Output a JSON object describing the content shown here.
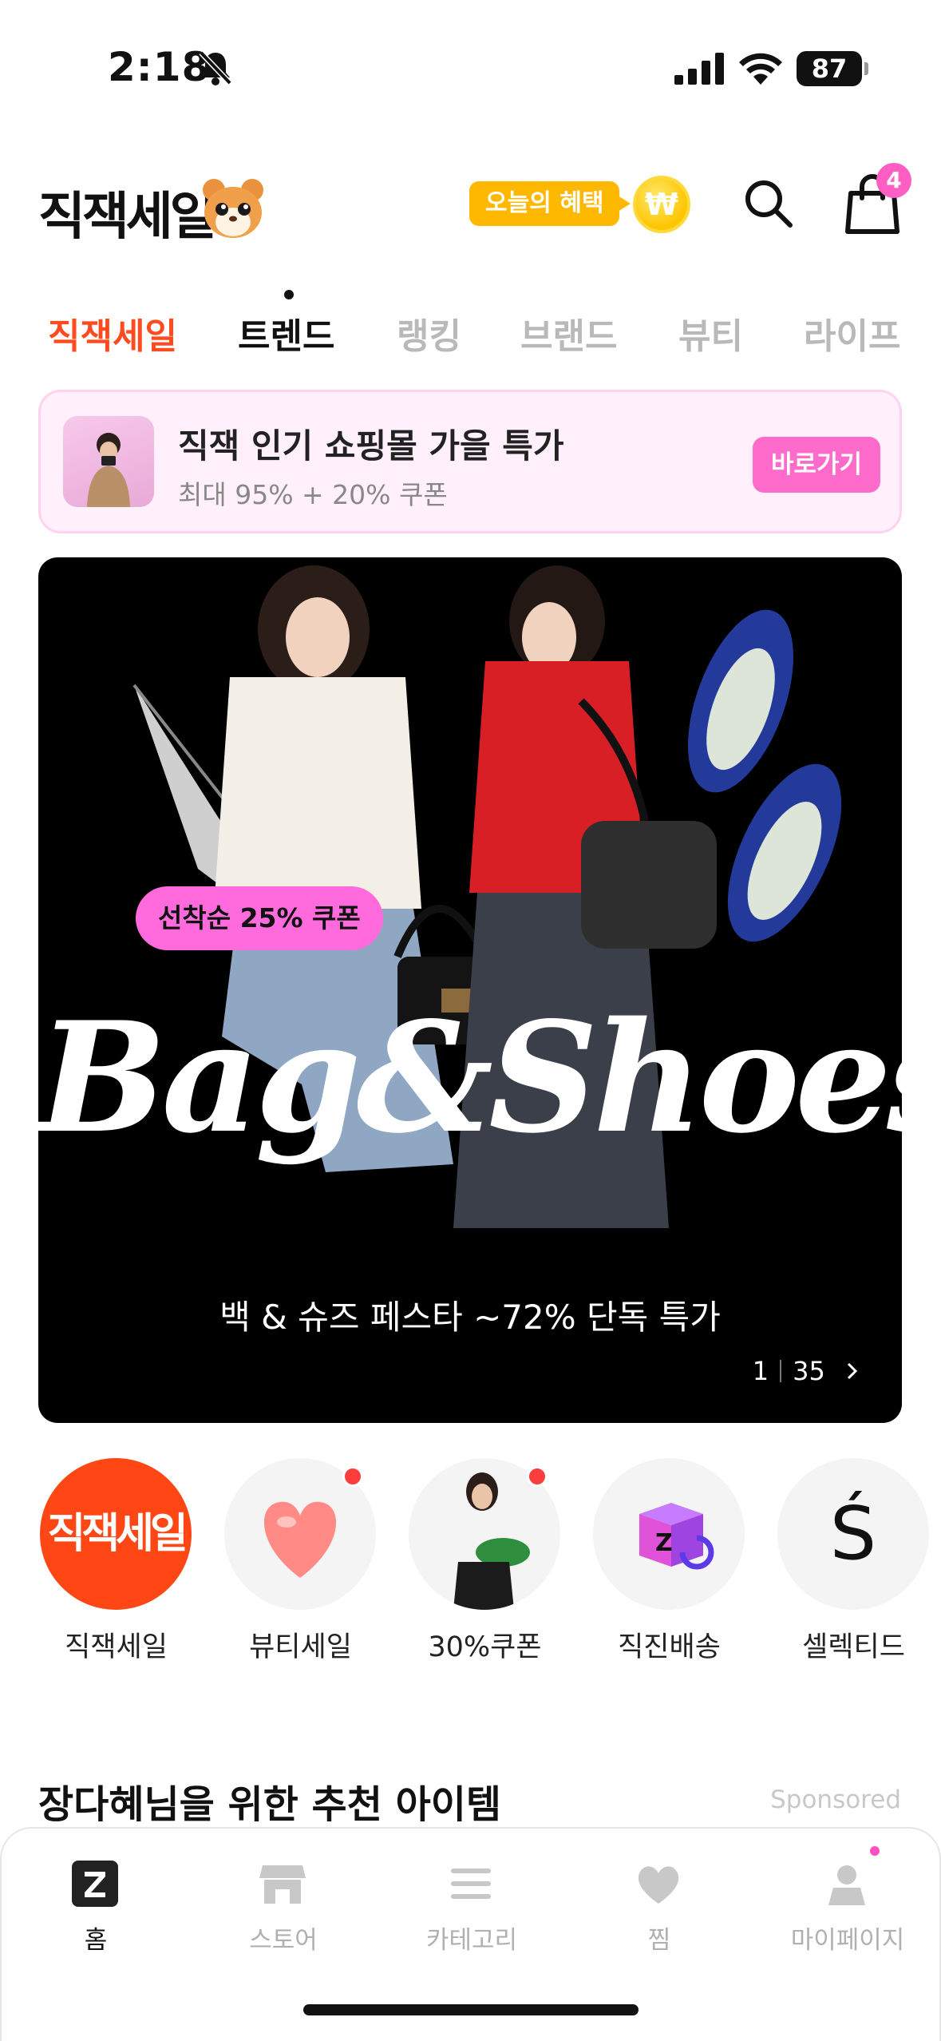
{
  "status_bar": {
    "time": "2:18",
    "battery": "87"
  },
  "header": {
    "logo_text": "직잭세일",
    "benefit_label": "오늘의 혜택",
    "coin_symbol": "₩",
    "cart_count": "4"
  },
  "tabs": [
    {
      "label": "직잭세일"
    },
    {
      "label": "트렌드"
    },
    {
      "label": "랭킹"
    },
    {
      "label": "브랜드"
    },
    {
      "label": "뷰티"
    },
    {
      "label": "라이프"
    }
  ],
  "promo": {
    "title": "직잭 인기 쇼핑몰 가을 특가",
    "subtitle": "최대 95% + 20% 쿠폰",
    "button": "바로가기"
  },
  "hero": {
    "coupon": "선착순 25% 쿠폰",
    "title": "Bag&Shoes",
    "caption": "백 & 슈즈 페스타 ~72% 단독 특가",
    "page_current": "1",
    "page_total": "35"
  },
  "shortcuts": [
    {
      "label": "직잭세일",
      "logo": "직잭세일"
    },
    {
      "label": "뷰티세일"
    },
    {
      "label": "30%쿠폰"
    },
    {
      "label": "직진배송"
    },
    {
      "label": "셀렉티드",
      "logo": "Ś"
    }
  ],
  "section": {
    "title": "장다혜님을 위한 추천 아이템",
    "sponsored": "Sponsored"
  },
  "bottom_nav": [
    {
      "label": "홈",
      "icon": "home-z-icon"
    },
    {
      "label": "스토어",
      "icon": "store-icon"
    },
    {
      "label": "카테고리",
      "icon": "menu-icon"
    },
    {
      "label": "찜",
      "icon": "heart-icon"
    },
    {
      "label": "마이페이지",
      "icon": "person-icon"
    }
  ],
  "colors": {
    "brand_red": "#FF4B1F",
    "pink": "#FF6BCB",
    "benefit_yellow": "#FFB800"
  }
}
